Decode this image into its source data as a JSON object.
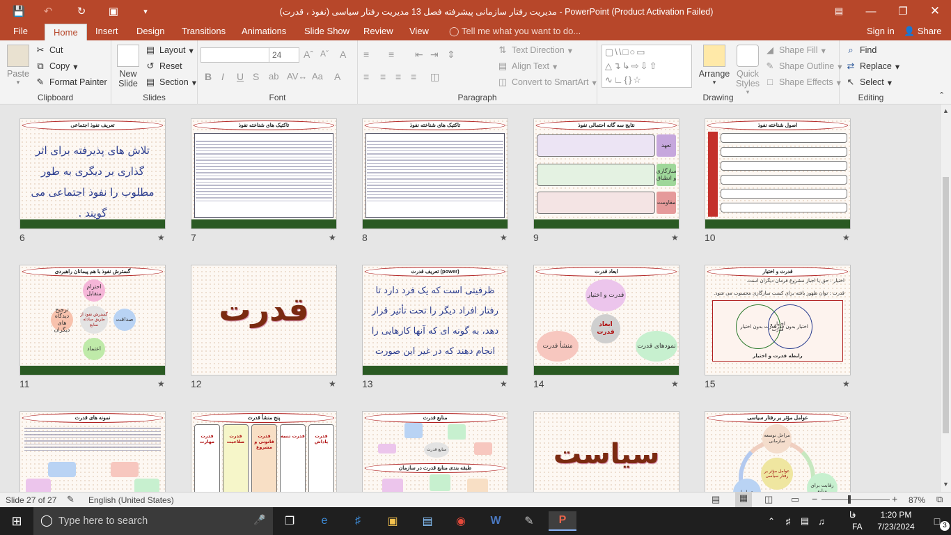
{
  "window": {
    "title": "مدیریت رفتار سازمانی پیشرفته فصل 13 مدیریت رفتار سیاسی (نفوذ ، قدرت) - PowerPoint (Product Activation Failed)"
  },
  "tabs": [
    "File",
    "Home",
    "Insert",
    "Design",
    "Transitions",
    "Animations",
    "Slide Show",
    "Review",
    "View"
  ],
  "tell_me": "Tell me what you want to do...",
  "signin": "Sign in",
  "share": "Share",
  "ribbon": {
    "clipboard": {
      "label": "Clipboard",
      "paste": "Paste",
      "cut": "Cut",
      "copy": "Copy",
      "format_painter": "Format Painter"
    },
    "slides": {
      "label": "Slides",
      "new_slide": "New Slide",
      "layout": "Layout",
      "reset": "Reset",
      "section": "Section"
    },
    "font": {
      "label": "Font",
      "font_size": "24",
      "bold": "B",
      "italic": "I",
      "underline": "U",
      "strike": "S",
      "shadow": "ab"
    },
    "paragraph": {
      "label": "Paragraph",
      "text_direction": "Text Direction",
      "align_text": "Align Text",
      "smartart": "Convert to SmartArt"
    },
    "drawing": {
      "label": "Drawing",
      "arrange": "Arrange",
      "quick_styles": "Quick Styles",
      "shape_fill": "Shape Fill",
      "shape_outline": "Shape Outline",
      "shape_effects": "Shape Effects"
    },
    "editing": {
      "label": "Editing",
      "find": "Find",
      "replace": "Replace",
      "select": "Select"
    }
  },
  "slides": [
    {
      "n": "6",
      "title": "تعریف نفوذ اجتماعی",
      "body": "تلاش های پذیرفته برای اثر گذاری بر دیگری به طور مطلوب را نفوذ اجتماعی می گویند ."
    },
    {
      "n": "7",
      "title": "تاکتیک های شناخته نفوذ"
    },
    {
      "n": "8",
      "title": "تاکتیک های شناخته نفوذ"
    },
    {
      "n": "9",
      "title": "نتایج سه گانه احتمالی نفوذ",
      "items": [
        "تعهد",
        "سازگاری و انطباق",
        "مقاومت"
      ]
    },
    {
      "n": "10",
      "title": "اصول شناخته نفوذ"
    },
    {
      "n": "11",
      "title": "گسترش نفوذ با هم پیمانان راهبردی",
      "items": [
        "احترام متقابل",
        "صداقت",
        "اعتماد",
        "ترجیح دیدگاه های دیگران",
        "گسترش نفوذ از طریق مبادله منابع"
      ]
    },
    {
      "n": "12",
      "big": "قدرت"
    },
    {
      "n": "13",
      "title": "تعریف قدرت (power)",
      "body": "ظرفیتی است که یک فرد دارد تا رفتار افراد دیگر را تحت تأثیر قرار دهد، به گونه ای که آنها کارهایی را انجام دهند که در غیر این صورت انجام نمی دادند."
    },
    {
      "n": "14",
      "title": "ابعاد قدرت",
      "items": [
        "قدرت و اختیار",
        "ابعاد قدرت",
        "نمودهای قدرت",
        "منشأ قدرت"
      ]
    },
    {
      "n": "15",
      "title": "قدرت و اختیار",
      "items": [
        "اختیار : حق یا اجبار مشروع فرمان دیگران است.",
        "قدرت : توان ظهور یافته برای کسب سازگاری محسوب می شود.",
        "قدرت بدون اختیار",
        "اختیار و قدرت",
        "اختیار بدون قدرت",
        "رابطه قدرت و اختیار"
      ]
    },
    {
      "n": "",
      "title": "نمونه های قدرت"
    },
    {
      "n": "",
      "title": "پنج منشأ قدرت",
      "items": [
        "قدرت پاداش",
        "قدرت تنبیه",
        "قدرت قانونی و مشروع",
        "قدرت صلاحیت",
        "قدرت مهارت"
      ]
    },
    {
      "n": "",
      "title": "منابع قدرت",
      "items": [
        "منابع قدرت",
        "طبقه بندی منابع قدرت در سازمان"
      ]
    },
    {
      "n": "",
      "big": "سیاست"
    },
    {
      "n": "",
      "title": "عوامل مؤثر بر رفتار سیاسی",
      "items": [
        "مراحل توسعه سازمانی",
        "عوامل مؤثر بر رفتار سیاسی",
        "رقابت برای منابع",
        "شرایط"
      ]
    }
  ],
  "status": {
    "slide": "Slide 27 of 27",
    "language": "English (United States)",
    "zoom": "87%"
  },
  "taskbar": {
    "search": "Type here to search",
    "time": "1:20 PM",
    "date": "7/23/2024",
    "lang": "FA",
    "notifications": "3",
    "lang_script": "فا"
  },
  "colors": {
    "accent": "#b7472a",
    "slide_title_border": "#b01e1e",
    "slide_footer": "#2a5a23"
  }
}
